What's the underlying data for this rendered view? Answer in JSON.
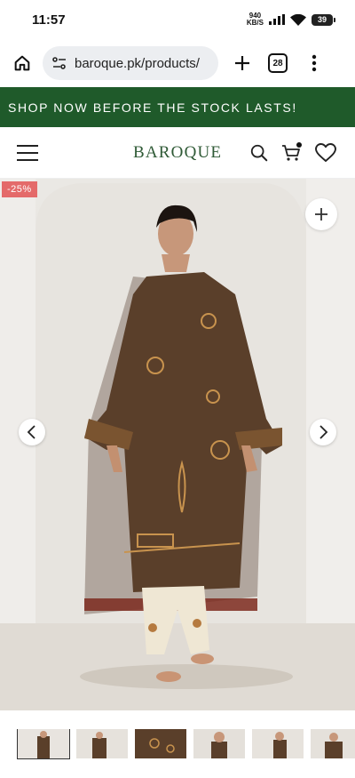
{
  "status": {
    "time": "11:57",
    "net_speed_value": "940",
    "net_speed_unit": "KB/S",
    "battery": "39"
  },
  "browser": {
    "url": "baroque.pk/products/",
    "tab_count": "28"
  },
  "promo": {
    "text": "SHOP NOW BEFORE THE STOCK LASTS!"
  },
  "header": {
    "logo": "BAROQUE"
  },
  "product": {
    "discount": "-25%"
  },
  "colors": {
    "banner_green": "#1f5a2a",
    "logo_green": "#2f5a36",
    "badge_red": "#e46a6a",
    "dress_brown": "#5a3f2a"
  },
  "icons": [
    "home-icon",
    "site-info-icon",
    "new-tab-icon",
    "tabs-icon",
    "more-icon",
    "hamburger-icon",
    "search-icon",
    "cart-icon",
    "heart-icon",
    "plus-icon",
    "chevron-left-icon",
    "chevron-right-icon"
  ],
  "thumbnails": [
    {
      "label": "thumbnail-1",
      "active": true
    },
    {
      "label": "thumbnail-2",
      "active": false
    },
    {
      "label": "thumbnail-3",
      "active": false
    },
    {
      "label": "thumbnail-4",
      "active": false
    },
    {
      "label": "thumbnail-5",
      "active": false
    },
    {
      "label": "thumbnail-6",
      "active": false
    }
  ]
}
